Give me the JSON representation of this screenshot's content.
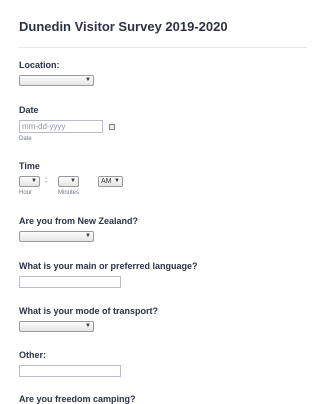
{
  "form": {
    "title": "Dunedin Visitor Survey 2019-2020",
    "location": {
      "label": "Location:",
      "value": ""
    },
    "date": {
      "label": "Date",
      "placeholder": "mm-dd-yyyy",
      "sublabel": "Date"
    },
    "time": {
      "label": "Time",
      "hour_value": "",
      "separator": ":",
      "minutes_value": "",
      "ampm_value": "AM",
      "hour_sublabel": "Hour",
      "minutes_sublabel": "Minutes"
    },
    "from_nz": {
      "label": "Are you from New Zealand?",
      "value": ""
    },
    "language": {
      "label": "What is your main or preferred language?",
      "value": ""
    },
    "transport": {
      "label": "What is your mode of transport?",
      "value": ""
    },
    "other": {
      "label": "Other:",
      "value": ""
    },
    "cut_off_label": "Are you freedom camping?"
  }
}
